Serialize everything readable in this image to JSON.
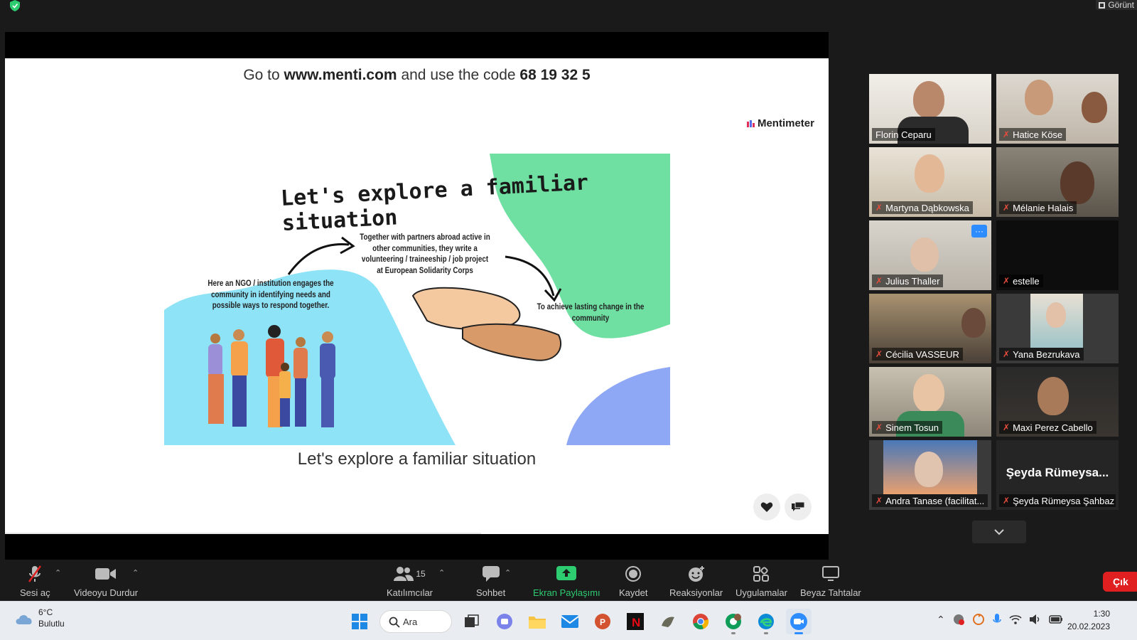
{
  "window": {
    "view_label": "Görünt"
  },
  "slide": {
    "code_prefix": "Go to ",
    "code_url": "www.menti.com",
    "code_middle": " and use the code ",
    "code": "68 19 32 5",
    "brand": "Mentimeter",
    "title": "Let's explore a familiar situation",
    "illustration": {
      "heading": "Let's explore a familiar situation",
      "text_left": "Here an NGO / institution engages the community in identifying needs and possible ways to respond together.",
      "text_center": "Together with partners abroad active in other communities, they write a volunteering / traineeship / job project at European Solidarity Corps",
      "text_right": "To achieve lasting change in the community"
    }
  },
  "participants": [
    {
      "name": "Florin Ceparu",
      "muted": false,
      "active": true
    },
    {
      "name": "Hatice Köse",
      "muted": true
    },
    {
      "name": "Martyna Dąbkowska",
      "muted": true
    },
    {
      "name": "Mélanie Halais",
      "muted": true
    },
    {
      "name": "Julius Thaller",
      "muted": true
    },
    {
      "name": "estelle",
      "muted": true
    },
    {
      "name": "Cécilia VASSEUR",
      "muted": true
    },
    {
      "name": "Yana Bezrukava",
      "muted": true
    },
    {
      "name": "Sinem Tosun",
      "muted": true
    },
    {
      "name": "Maxi Perez Cabello",
      "muted": true
    },
    {
      "name": "Andra Tanase (facilitat...",
      "muted": true
    },
    {
      "name": "Şeyda Rümeysa Şahbaz",
      "muted": true,
      "display": "Şeyda Rümeysa..."
    }
  ],
  "toolbar": {
    "unmute": "Sesi aç",
    "video": "Videoyu Durdur",
    "participants": "Katılımcılar",
    "participants_count": "15",
    "chat": "Sohbet",
    "share": "Ekran Paylaşımı",
    "record": "Kaydet",
    "reactions": "Reaksiyonlar",
    "apps": "Uygulamalar",
    "whiteboards": "Beyaz Tahtalar",
    "leave": "Çık"
  },
  "taskbar": {
    "temp": "6°C",
    "condition": "Bulutlu",
    "search": "Ara",
    "time": "1:30",
    "date": "20.02.2023"
  },
  "colors": {
    "share_green": "#2ecc71",
    "active_border": "#b7e43a",
    "leave_red": "#e02020",
    "blob_blue": "#8ee3f7",
    "blob_green": "#6fe0a2",
    "blob_purple": "#8fa8f5"
  }
}
